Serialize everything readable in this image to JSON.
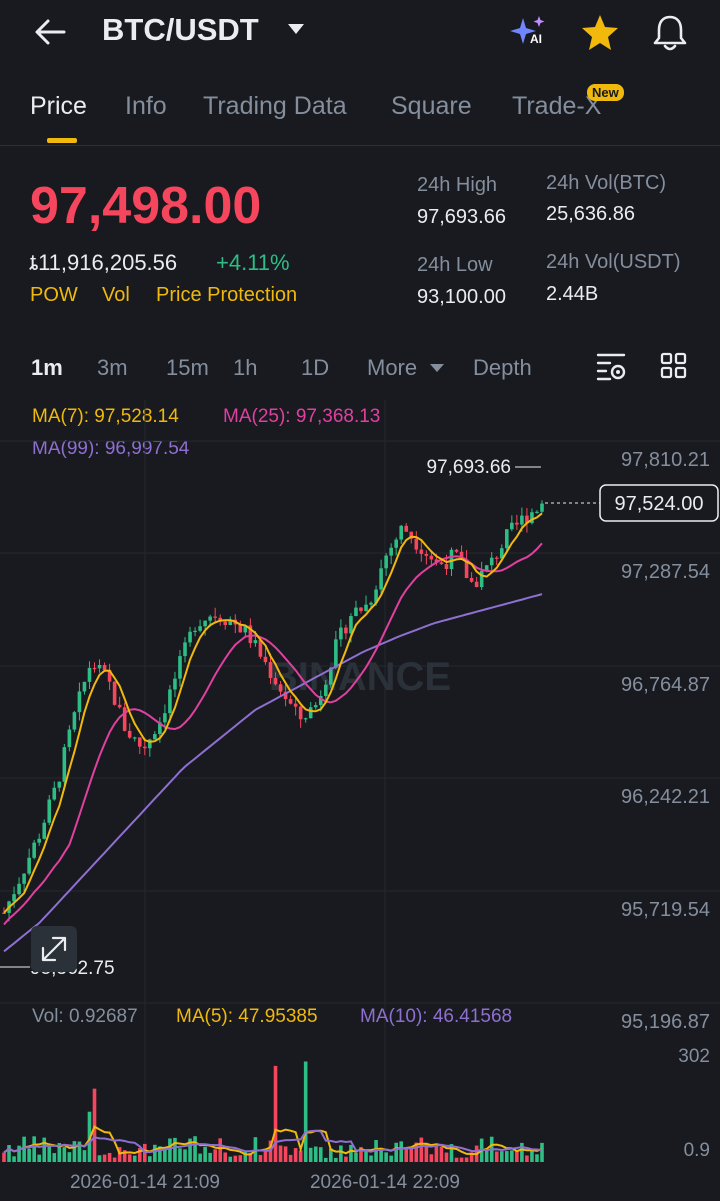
{
  "header": {
    "pair": "BTC/USDT",
    "icons": [
      "back-arrow-icon",
      "ai-sparkle-icon",
      "favorite-star-icon",
      "notification-bell-icon"
    ],
    "ai_label": "AI"
  },
  "tabs": [
    {
      "label": "Price",
      "active": true
    },
    {
      "label": "Info"
    },
    {
      "label": "Trading Data"
    },
    {
      "label": "Square"
    },
    {
      "label": "Trade-X",
      "badge": "New"
    }
  ],
  "ticker": {
    "last_price": "97,498.00",
    "fiat_price": "ȶ11,916,205.56",
    "change_pct": "+4.11%",
    "tags": [
      "POW",
      "Vol",
      "Price Protection"
    ],
    "stats": [
      {
        "label": "24h High",
        "value": "97,693.66"
      },
      {
        "label": "24h Vol(BTC)",
        "value": "25,636.86"
      },
      {
        "label": "24h Low",
        "value": "93,100.00"
      },
      {
        "label": "24h Vol(USDT)",
        "value": "2.44B"
      }
    ]
  },
  "timeframes": {
    "options": [
      "1m",
      "3m",
      "15m",
      "1h",
      "1D",
      "More",
      "Depth"
    ],
    "selected": "1m"
  },
  "colors": {
    "up": "#2ebd85",
    "down": "#f6465d",
    "ma7": "#f0b90b",
    "ma25": "#e040a0",
    "ma99": "#8f6fd0",
    "accent": "#f0b90b",
    "bg": "#181a20"
  },
  "chart_data": {
    "type": "candlestick",
    "watermark": "BINANCE",
    "ma_labels": [
      "MA(7): 97,528.14",
      "MA(25): 97,368.13",
      "MA(99): 96,997.54"
    ],
    "y_ticks": [
      "97,810.21",
      "97,287.54",
      "96,764.87",
      "96,242.21",
      "95,719.54",
      "95,196.87"
    ],
    "ylim": [
      95000,
      97900
    ],
    "high_label": "97,693.66",
    "low_label": "95,362.75",
    "current_price_label": "97,524.00",
    "x_ticks": [
      "2026-01-14 21:09",
      "2026-01-14 22:09"
    ],
    "close_path": [
      95400,
      95600,
      95800,
      96050,
      96400,
      96700,
      96600,
      96350,
      96250,
      96400,
      96650,
      96900,
      96950,
      96920,
      96850,
      96700,
      96550,
      96400,
      96480,
      96750,
      96950,
      97000,
      97250,
      97400,
      97300,
      97200,
      97250,
      97100,
      97200,
      97350,
      97450,
      97520
    ],
    "ma99_path": [
      95200,
      95350,
      95550,
      95750,
      95950,
      96150,
      96300,
      96450,
      96550,
      96650,
      96750,
      96830,
      96900,
      96950,
      97000,
      97050
    ],
    "volume": {
      "vol_label": "Vol: 0.92687",
      "ma5_label": "MA(5): 47.95385",
      "ma10_label": "MA(10): 46.41568",
      "y_ticks": [
        "302",
        "0.9"
      ],
      "ylim": [
        0.9,
        302
      ]
    }
  }
}
